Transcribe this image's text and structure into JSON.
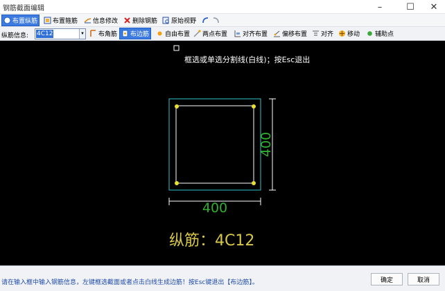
{
  "window": {
    "title": "钢筋截面编辑"
  },
  "toolbar1": [
    {
      "label": "布置纵筋",
      "icon": "rebar-longitudinal-icon",
      "active": true
    },
    {
      "label": "布置箍筋",
      "icon": "stirrup-icon",
      "active": false
    },
    {
      "label": "信息修改",
      "icon": "edit-info-icon",
      "active": false
    },
    {
      "label": "删除钢筋",
      "icon": "delete-x-icon",
      "active": false
    },
    {
      "label": "原始视野",
      "icon": "zoom-reset-icon",
      "active": false
    }
  ],
  "toolbar2": {
    "field_label": "纵筋信息:",
    "field_value": "4C12",
    "buttons": [
      {
        "label": "布角筋",
        "icon": "corner-rebar-icon",
        "active": false
      },
      {
        "label": "布边筋",
        "icon": "edge-rebar-icon",
        "active": true
      },
      {
        "label": "自由布置",
        "icon": "free-place-icon",
        "active": false
      },
      {
        "label": "两点布置",
        "icon": "two-point-icon",
        "active": false
      },
      {
        "label": "对齐布置",
        "icon": "align-place-icon",
        "active": false
      },
      {
        "label": "偏移布置",
        "icon": "offset-place-icon",
        "active": false
      },
      {
        "label": "对齐",
        "icon": "align-icon",
        "active": false
      },
      {
        "label": "移动",
        "icon": "move-icon",
        "active": false
      },
      {
        "label": "辅助点",
        "icon": "aux-point-icon",
        "active": false
      }
    ]
  },
  "canvas": {
    "prompt": "框选或单选分割线(白线)；按Esc退出",
    "dim_bottom": "400",
    "dim_right": "400",
    "rebar_label": "纵筋：4C12",
    "colors": {
      "bg": "#000000",
      "outline": "#2ec4c8",
      "core": "#ffffff",
      "dim": "#ffffff",
      "dim_text": "#2fae2f",
      "rebar": "#e8e030",
      "label": "#d8c84a"
    }
  },
  "status": {
    "message": "请在输入框中输入钢筋信息，左键框选截面或者点击白线生成边筋！按Esc键退出【布边筋】。",
    "ok": "确定",
    "cancel": "取消"
  }
}
